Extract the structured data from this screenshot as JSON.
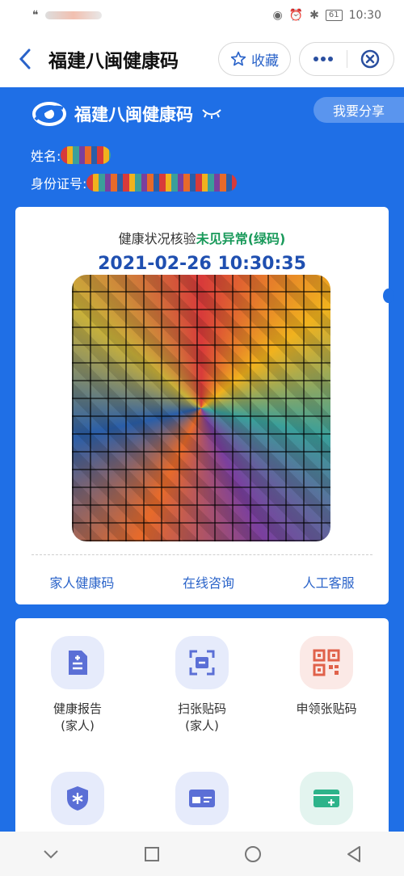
{
  "status_bar": {
    "battery": "61",
    "time": "10:30"
  },
  "nav": {
    "title": "福建八闽健康码",
    "favorite_label": "收藏"
  },
  "header": {
    "brand_title": "福建八闽健康码",
    "share_label": "我要分享",
    "name_label": "姓名:",
    "id_label": "身份证号:"
  },
  "card": {
    "status_prefix": "健康状况核验",
    "status_value": "未见异常(绿码)",
    "timestamp": "2021-02-26 10:30:35",
    "links": [
      "家人健康码",
      "在线咨询",
      "人工客服"
    ]
  },
  "services": [
    {
      "label": "健康报告",
      "sub": "(家人)",
      "icon": "document-icon"
    },
    {
      "label": "扫张贴码",
      "sub": "(家人)",
      "icon": "scan-icon"
    },
    {
      "label": "申领张贴码",
      "sub": "",
      "icon": "qr-code-icon"
    },
    {
      "label": "",
      "sub": "",
      "icon": "shield-icon"
    },
    {
      "label": "",
      "sub": "",
      "icon": "id-card-icon"
    },
    {
      "label": "",
      "sub": "",
      "icon": "card-add-icon"
    }
  ],
  "colors": {
    "brand_blue": "#1f6fe6",
    "link_blue": "#2a63c9",
    "green": "#1a9a5b"
  }
}
